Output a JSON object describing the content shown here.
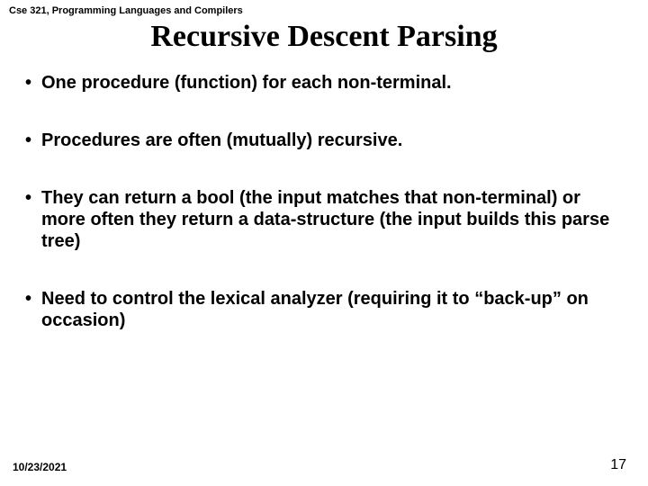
{
  "header": {
    "course": "Cse 321, Programming Languages and Compilers"
  },
  "title": "Recursive Descent Parsing",
  "bullets": [
    "One procedure (function) for each non-terminal.",
    "Procedures are often (mutually) recursive.",
    "They can return a bool (the input matches that non-terminal) or more often they return a data-structure (the input builds this parse tree)",
    "Need to control the lexical analyzer  (requiring it to “back-up” on occasion)"
  ],
  "footer": {
    "date": "10/23/2021",
    "page": "17"
  }
}
